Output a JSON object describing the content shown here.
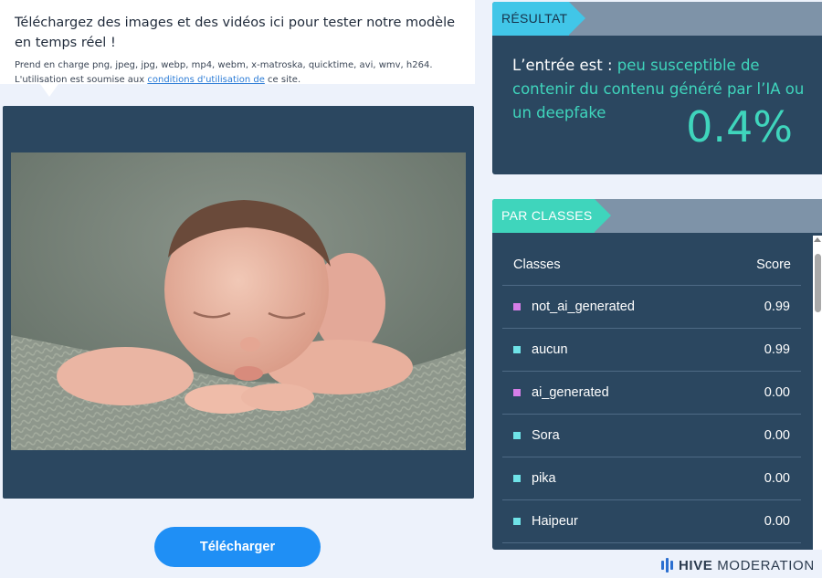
{
  "upload": {
    "title": "Téléchargez des images et des vidéos ici pour tester notre modèle en temps réel !",
    "supported": "Prend en charge png, jpeg, jpg, webp, mp4, webm, x-matroska, quicktime, avi, wmv, h264.",
    "terms_prefix": "L'utilisation est soumise aux",
    "terms_link": "conditions d'utilisation de",
    "terms_suffix": "ce site.",
    "button_label": "Télécharger"
  },
  "result": {
    "tag": "RÉSULTAT",
    "prefix": "L’entrée est :",
    "verdict": "peu susceptible de contenir du contenu généré par l’IA ou un deepfake",
    "percentage": "0.4%"
  },
  "classes": {
    "tag": "PAR CLASSES",
    "col_classes": "Classes",
    "col_score": "Score",
    "rows": [
      {
        "name": "not_ai_generated",
        "score": "0.99",
        "color": "#d67ee8"
      },
      {
        "name": "aucun",
        "score": "0.99",
        "color": "#6fe3e8"
      },
      {
        "name": "ai_generated",
        "score": "0.00",
        "color": "#d67ee8"
      },
      {
        "name": "Sora",
        "score": "0.00",
        "color": "#6fe3e8"
      },
      {
        "name": "pika",
        "score": "0.00",
        "color": "#6fe3e8"
      },
      {
        "name": "Haipeur",
        "score": "0.00",
        "color": "#6fe3e8"
      }
    ]
  },
  "brand": {
    "name_bold": "HIVE",
    "name_rest": "MODERATION"
  },
  "colors": {
    "panel": "#2b4760",
    "accent_teal": "#3fd5bc",
    "accent_blue": "#41c6e8",
    "button": "#1f8ff5"
  }
}
